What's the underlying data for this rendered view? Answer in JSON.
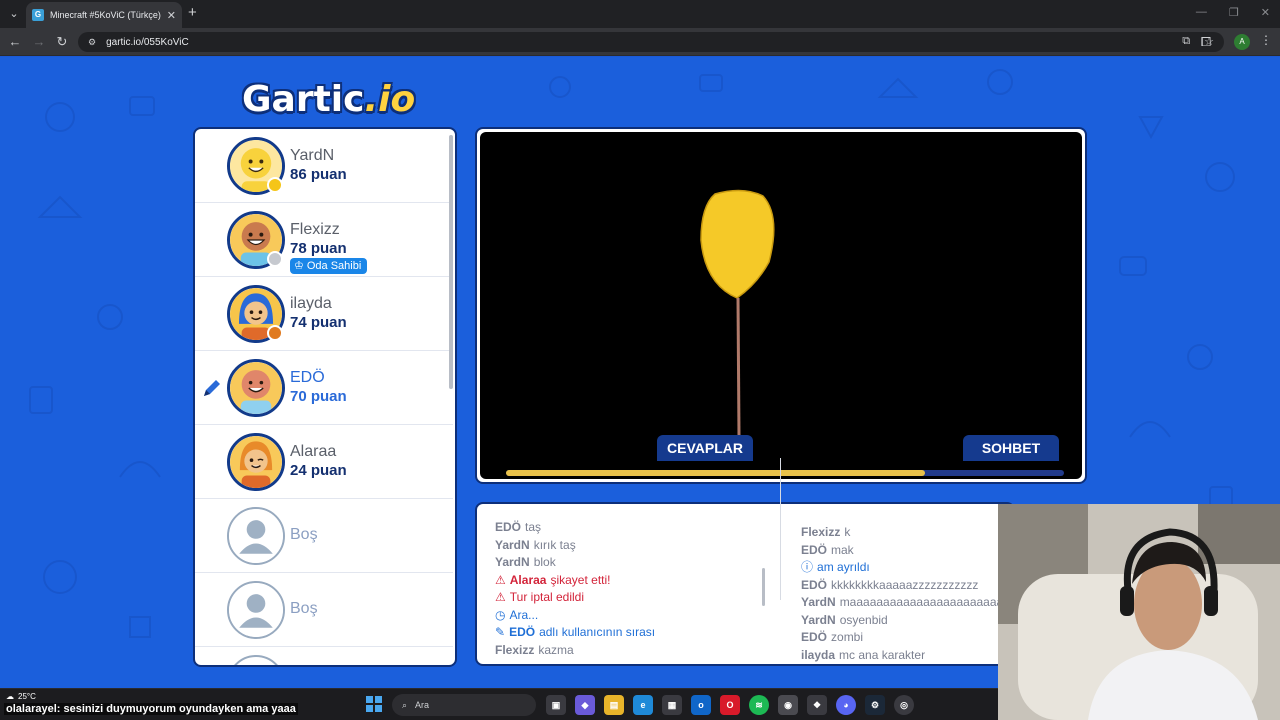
{
  "browser": {
    "tab_title": "Minecraft #5KoViC (Türkçe) - G",
    "tab_favicon_letter": "G",
    "url": "gartic.io/055KoViC",
    "profile_letter": "A"
  },
  "logo": {
    "text_main": "Gartic",
    "text_suffix": ".io"
  },
  "players": [
    {
      "name": "YardN",
      "score": "86 puan",
      "status_color": "#f5c518",
      "skin": "#f8d23c"
    },
    {
      "name": "Flexizz",
      "score": "78 puan",
      "status_color": "#c6c9cf",
      "badge": "Oda Sahibi",
      "skin": "#c97a4e"
    },
    {
      "name": "ilayda",
      "score": "74 puan",
      "status_color": "#e07a1f",
      "skin": "#f2c48c"
    },
    {
      "name": "EDÖ",
      "score": "70 puan",
      "active": true,
      "skin": "#e0866a"
    },
    {
      "name": "Alaraa",
      "score": "24 puan",
      "skin": "#f2c48c"
    },
    {
      "name": "Boş"
    },
    {
      "name": "Boş"
    }
  ],
  "canvas": {
    "timer_progress": 0.75
  },
  "tabs": {
    "answers": "CEVAPLAR",
    "chat": "SOHBET"
  },
  "answers": [
    {
      "user": "EDÖ",
      "text": "taş"
    },
    {
      "user": "YardN",
      "text": "kırık taş"
    },
    {
      "user": "YardN",
      "text": "blok"
    },
    {
      "type": "alert",
      "user": "Alaraa",
      "text": "şikayet etti!"
    },
    {
      "type": "alert",
      "text": "Tur iptal edildi"
    },
    {
      "type": "info",
      "text": "Ara..."
    },
    {
      "type": "info",
      "user": "EDÖ",
      "text": "adlı kullanıcının sırası"
    },
    {
      "user": "Flexizz",
      "text": "kazma"
    }
  ],
  "chat": [
    {
      "user": "Flexizz",
      "text": "k"
    },
    {
      "user": "EDÖ",
      "text": "mak"
    },
    {
      "type": "info",
      "text": "am ayrıldı"
    },
    {
      "user": "EDÖ",
      "text": "kkkkkkkkaaaaazzzzzzzzzzz"
    },
    {
      "user": "YardN",
      "text": "maaaaaaaaaaaaaaaaaaaaaaa"
    },
    {
      "user": "YardN",
      "text": "osyenbid"
    },
    {
      "user": "EDÖ",
      "text": "zombi"
    },
    {
      "user": "ilayda",
      "text": "mc ana karakter"
    }
  ],
  "taskbar": {
    "weather": "25°C",
    "subtitle_user": "olalarayel",
    "subtitle_text": "sesinizi duymuyorum oyundayken ama yaaa",
    "search_label": "Ara"
  }
}
